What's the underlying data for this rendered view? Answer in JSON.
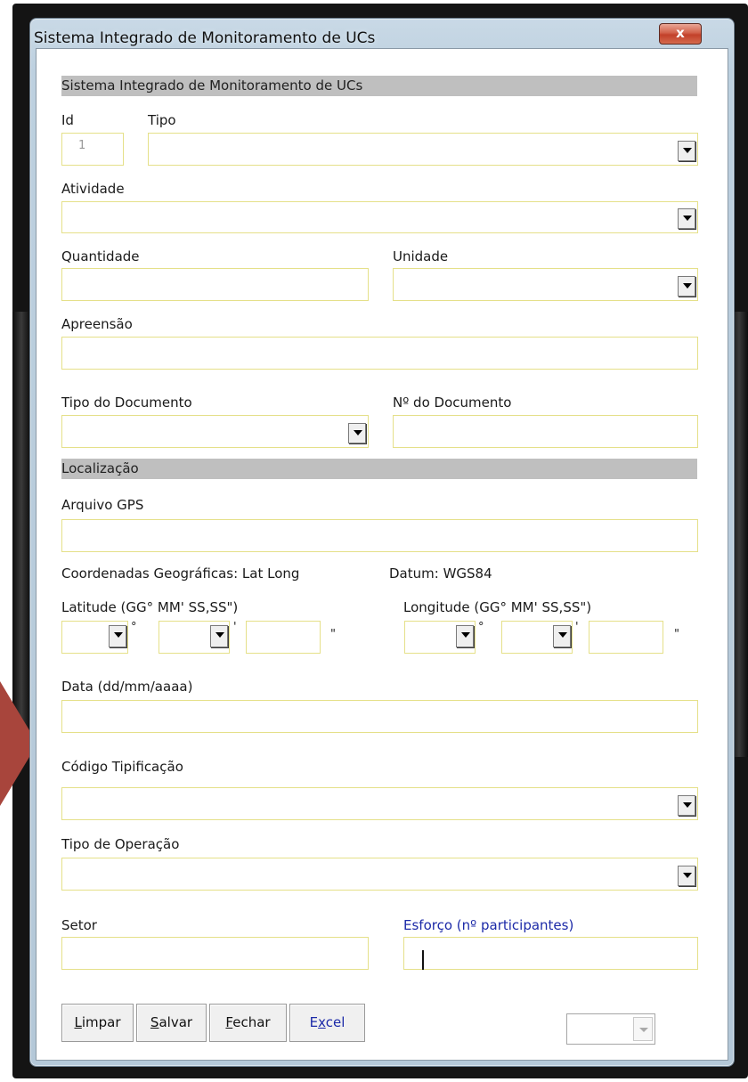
{
  "window": {
    "title": "Sistema Integrado de Monitoramento de UCs",
    "close_glyph": "x"
  },
  "sections": {
    "header": "Sistema Integrado de Monitoramento de UCs",
    "location": "Localização"
  },
  "fields": {
    "id_label": "Id",
    "id_value": "1",
    "tipo_label": "Tipo",
    "atividade_label": "Atividade",
    "quantidade_label": "Quantidade",
    "unidade_label": "Unidade",
    "apreensao_label": "Apreensão",
    "tipo_documento_label": "Tipo do Documento",
    "num_documento_label": "Nº do Documento",
    "arquivo_gps_label": "Arquivo GPS",
    "coordenadas_label": "Coordenadas Geográficas: Lat Long",
    "datum_label": "Datum: WGS84",
    "latitude_label": "Latitude (GG° MM' SS,SS\")",
    "longitude_label": "Longitude (GG° MM' SS,SS\")",
    "degree_mark": "°",
    "minute_mark": "'",
    "second_mark": "\"",
    "data_label": "Data (dd/mm/aaaa)",
    "codigo_label": "Código Tipificação",
    "operacao_label": "Tipo de Operação",
    "setor_label": "Setor",
    "esforco_label": "Esforço (nº participantes)"
  },
  "buttons": {
    "limpar_mnemonic": "L",
    "limpar_rest": "impar",
    "salvar_mnemonic": "S",
    "salvar_rest": "alvar",
    "fechar_mnemonic": "F",
    "fechar_rest": "echar",
    "excel_pre": "E",
    "excel_mnemonic": "x",
    "excel_rest": "cel"
  },
  "colors": {
    "field_border": "#e5e089",
    "section_bar": "#bfbfbf",
    "blue_label": "#1c2aa8",
    "accent_arrow": "#a8453c"
  },
  "icons": [
    "close-icon",
    "dropdown-arrow-icon",
    "text-cursor"
  ]
}
